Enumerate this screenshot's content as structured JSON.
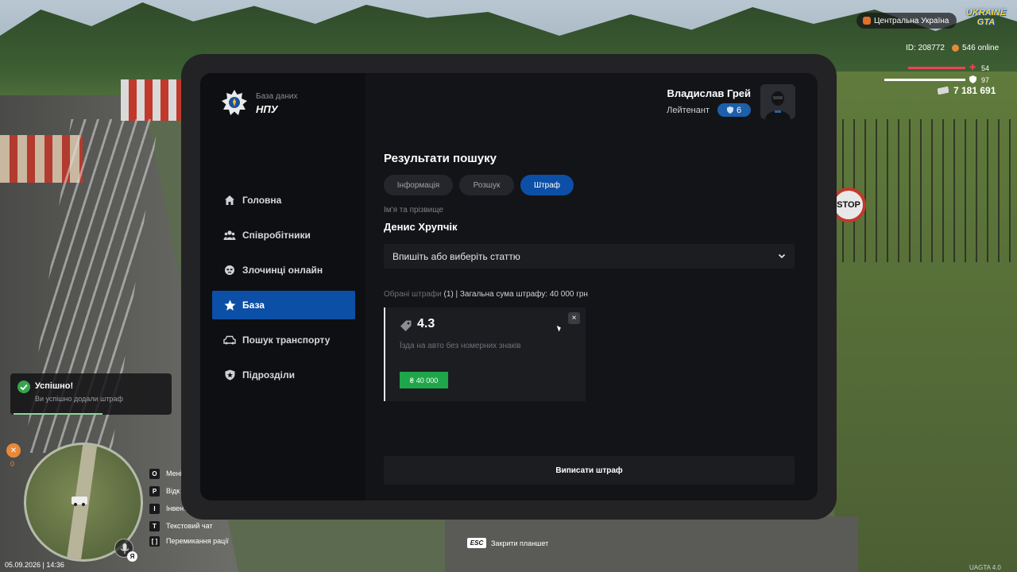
{
  "hud": {
    "region": "Центральна Україна",
    "game_logo_top": "UKRAINE",
    "game_logo_bottom": "GTA",
    "player_id": "ID: 208772",
    "online": "546 online",
    "health": "54",
    "armor": "97",
    "money": "7 181 691",
    "hunger": "0",
    "mic_lang": "Я",
    "datetime": "05.09.2026 | 14:36",
    "version": "UAGTA 4.0",
    "key_hints": [
      {
        "key": "O",
        "label": "Мені"
      },
      {
        "key": "P",
        "label": "Відк"
      },
      {
        "key": "I",
        "label": "Інвент"
      },
      {
        "key": "T",
        "label": "Текстовий чат"
      },
      {
        "key": "[ ]",
        "label": "Перемикання рації"
      }
    ],
    "esc_key": "ESC",
    "esc_label": "Закрити планшет",
    "colors": {
      "health": "#ef4257",
      "accent": "#0c4fa6",
      "success": "#1fa64a"
    }
  },
  "toast": {
    "title": "Успішно!",
    "message": "Ви успішно додали штраф"
  },
  "tablet": {
    "brand_sub": "База даних",
    "brand_name": "НПУ",
    "user": {
      "name": "Владислав Грей",
      "rank": "Лейтенант",
      "rank_level": "6"
    },
    "nav": [
      {
        "label": "Головна",
        "icon": "home-icon"
      },
      {
        "label": "Співробітники",
        "icon": "users-icon"
      },
      {
        "label": "Злочинці онлайн",
        "icon": "mask-icon"
      },
      {
        "label": "База",
        "icon": "star-icon",
        "active": true
      },
      {
        "label": "Пошук транспорту",
        "icon": "car-icon"
      },
      {
        "label": "Підрозділи",
        "icon": "shield-icon"
      }
    ],
    "section_title": "Результати пошуку",
    "tabs": [
      {
        "label": "Інформація"
      },
      {
        "label": "Розшук"
      },
      {
        "label": "Штраф",
        "active": true
      }
    ],
    "name_label": "Ім'я та прізвище",
    "person_name": "Денис Хрупчік",
    "article_placeholder": "Впишіть або виберіть статтю",
    "summary_prefix": "Обрані штрафи",
    "summary_rest": "(1) | Загальна сума штрафу: 40 000 грн",
    "fines": [
      {
        "code": "4.3",
        "description": "Їзда на авто без номерних знаків",
        "amount_symbol": "₴",
        "amount": "40 000"
      }
    ],
    "close_glyph": "×",
    "submit_label": "Виписати штраф"
  }
}
